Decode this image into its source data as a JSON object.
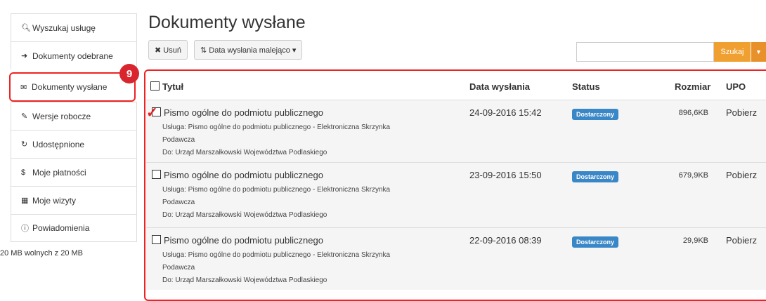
{
  "sidebar": {
    "items": [
      {
        "icon": "search-icon",
        "glyph": "🔍︎",
        "label": "Wyszukaj usługę"
      },
      {
        "icon": "arrow-right-icon",
        "glyph": "➜",
        "label": "Dokumenty odebrane"
      },
      {
        "icon": "envelope-icon",
        "glyph": "✉",
        "label": "Dokumenty wysłane"
      },
      {
        "icon": "pencil-icon",
        "glyph": "✎",
        "label": "Wersje robocze"
      },
      {
        "icon": "share-icon",
        "glyph": "↻",
        "label": "Udostępnione"
      },
      {
        "icon": "dollar-icon",
        "glyph": "$",
        "label": "Moje płatności"
      },
      {
        "icon": "calendar-icon",
        "glyph": "▦",
        "label": "Moje wizyty"
      },
      {
        "icon": "info-icon",
        "glyph": "ⓘ",
        "label": "Powiadomienia"
      }
    ],
    "quota": "20 MB wolnych z 20 MB"
  },
  "badge": "9",
  "page_title": "Dokumenty wysłane",
  "toolbar": {
    "delete_label": "✖ Usuń",
    "sort_label": "⇅ Data wysłania malejąco ▾"
  },
  "search": {
    "button": "Szukaj",
    "placeholder": ""
  },
  "table": {
    "headers": {
      "title": "Tytuł",
      "date": "Data wysłania",
      "status": "Status",
      "size": "Rozmiar",
      "upo": "UPO"
    },
    "rows": [
      {
        "title": "Pismo ogólne do podmiotu publicznego",
        "service": "Usługa: Pismo ogólne do podmiotu publicznego - Elektroniczna Skrzynka",
        "service2": "Podawcza",
        "to": "Do: Urząd Marszałkowski Województwa Podlaskiego",
        "date": "24-09-2016 15:42",
        "status": "Dostarczony",
        "size": "896,6KB",
        "upo": "Pobierz"
      },
      {
        "title": "Pismo ogólne do podmiotu publicznego",
        "service": "Usługa: Pismo ogólne do podmiotu publicznego - Elektroniczna Skrzynka",
        "service2": "Podawcza",
        "to": "Do: Urząd Marszałkowski Województwa Podlaskiego",
        "date": "23-09-2016 15:50",
        "status": "Dostarczony",
        "size": "679,9KB",
        "upo": "Pobierz"
      },
      {
        "title": "Pismo ogólne do podmiotu publicznego",
        "service": "Usługa: Pismo ogólne do podmiotu publicznego - Elektroniczna Skrzynka",
        "service2": "Podawcza",
        "to": "Do: Urząd Marszałkowski Województwa Podlaskiego",
        "date": "22-09-2016 08:39",
        "status": "Dostarczony",
        "size": "29,9KB",
        "upo": "Pobierz"
      }
    ]
  },
  "colors": {
    "accent": "#f0a030",
    "highlight": "#e22222",
    "status": "#3a87c8"
  }
}
